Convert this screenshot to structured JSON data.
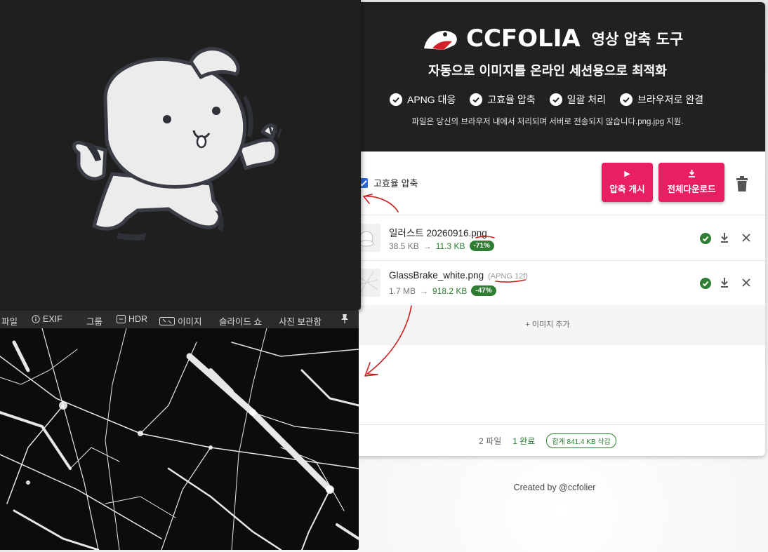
{
  "header": {
    "brand": "CCFOLIA",
    "tool_name": "영상 압축 도구",
    "subtitle": "자동으로 이미지를 온라인 세션용으로 최적화",
    "features": [
      "APNG 대응",
      "고효율 압축",
      "일괄 처리",
      "브라우저로 완결"
    ],
    "notice": "파일은 당신의 브라우저 내에서 처리되며 서버로 전송되지 않습니다.png.jpg 지원."
  },
  "toolbar": {
    "high_efficiency_label": "고효율 압축",
    "high_efficiency_checked": true,
    "start_button": "압축 개시",
    "download_all_button": "전체다운로드"
  },
  "files": [
    {
      "name": "일러스트 20260916.png",
      "tag": "",
      "size_before": "38.5 KB",
      "arrow": "→",
      "size_after": "11.3 KB",
      "reduction": "-71%"
    },
    {
      "name": "GlassBrake_white.png",
      "tag": "(APNG 12f)",
      "size_before": "1.7 MB",
      "arrow": "→",
      "size_after": "918.2 KB",
      "reduction": "-47%"
    }
  ],
  "add_image_label": "+ 이미지 추가",
  "summary": {
    "files": "2 파일",
    "done": "1 완료",
    "saved": "합계 841.4 KB 삭감"
  },
  "credit": "Created by @ccfolier",
  "viewer": {
    "toolbar": [
      "파일",
      "EXIF",
      "그룹",
      "HDR",
      "이미지",
      "슬라이드 쇼",
      "사진 보관함"
    ]
  },
  "colors": {
    "accent_pink": "#e91e63",
    "success_green": "#2e7d32",
    "header_bg": "#212121",
    "annotation_red": "#d01c1c"
  }
}
